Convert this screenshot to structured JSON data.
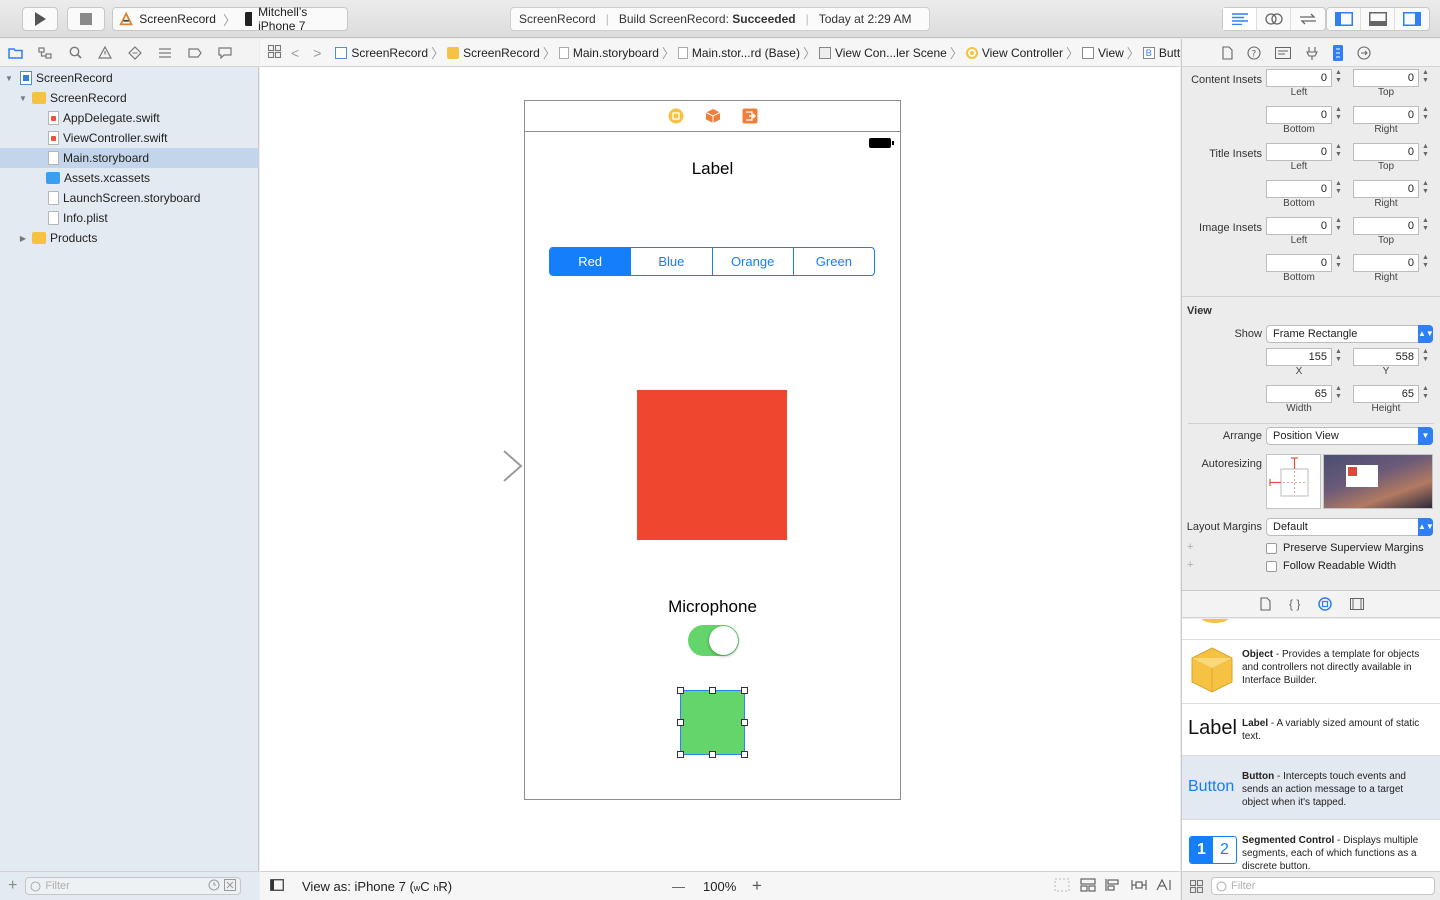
{
  "toolbar": {
    "scheme_name": "ScreenRecord",
    "device_name": "Mitchell’s iPhone 7",
    "status_app": "ScreenRecord",
    "status_build_prefix": "Build ScreenRecord:",
    "status_build_result": "Succeeded",
    "status_time": "Today at 2:29 AM"
  },
  "navigator": {
    "project": "ScreenRecord",
    "group": "ScreenRecord",
    "files": [
      "AppDelegate.swift",
      "ViewController.swift",
      "Main.storyboard",
      "Assets.xcassets",
      "LaunchScreen.storyboard",
      "Info.plist"
    ],
    "products": "Products",
    "filter_placeholder": "Filter"
  },
  "jumpbar": {
    "crumbs": [
      "ScreenRecord",
      "ScreenRecord",
      "Main.storyboard",
      "Main.stor...rd (Base)",
      "View Con...ler Scene",
      "View Controller",
      "View",
      "Button"
    ]
  },
  "canvas": {
    "label_text": "Label",
    "segments": [
      "Red",
      "Blue",
      "Orange",
      "Green"
    ],
    "selected_segment": 0,
    "microphone_label": "Microphone",
    "switch_on": true,
    "colors": {
      "accent": "#157efb",
      "red_square": "#ef4630",
      "green_square": "#63d56a",
      "switch_on": "#63d56a"
    }
  },
  "canvas_footer": {
    "view_as": "View as: iPhone 7",
    "size_class_w": "w",
    "size_class_wv": "C",
    "size_class_h": "h",
    "size_class_hv": "R",
    "zoom": "100%",
    "minus": "—",
    "plus": "+"
  },
  "inspector": {
    "content_insets_label": "Content Insets",
    "title_insets_label": "Title Insets",
    "image_insets_label": "Image Insets",
    "content_insets": {
      "left": "0",
      "top": "0",
      "bottom": "0",
      "right": "0"
    },
    "title_insets": {
      "left": "0",
      "top": "0",
      "bottom": "0",
      "right": "0"
    },
    "image_insets": {
      "left": "0",
      "top": "0",
      "bottom": "0",
      "right": "0"
    },
    "sub_left": "Left",
    "sub_top": "Top",
    "sub_bottom": "Bottom",
    "sub_right": "Right",
    "view_section": "View",
    "show_label": "Show",
    "show_value": "Frame Rectangle",
    "x_value": "155",
    "y_value": "558",
    "width_value": "65",
    "height_value": "65",
    "sub_x": "X",
    "sub_y": "Y",
    "sub_width": "Width",
    "sub_height": "Height",
    "arrange_label": "Arrange",
    "arrange_value": "Position View",
    "autoresizing_label": "Autoresizing",
    "layout_margins_label": "Layout Margins",
    "layout_margins_value": "Default",
    "preserve_label": "Preserve Superview Margins",
    "readable_label": "Follow Readable Width",
    "plus": "+"
  },
  "library": {
    "items": [
      {
        "title": "Object",
        "desc": " - Provides a template for objects and controllers not directly available in Interface Builder."
      },
      {
        "title": "Label",
        "desc": " - A variably sized amount of static text.",
        "preview": "Label"
      },
      {
        "title": "Button",
        "desc": " - Intercepts touch events and sends an action message to a target object when it's tapped.",
        "preview": "Button"
      },
      {
        "title": "Segmented Control",
        "desc": " - Displays multiple segments, each of which functions as a discrete button.",
        "preview_1": "1",
        "preview_2": "2"
      }
    ],
    "filter_placeholder": "Filter"
  }
}
